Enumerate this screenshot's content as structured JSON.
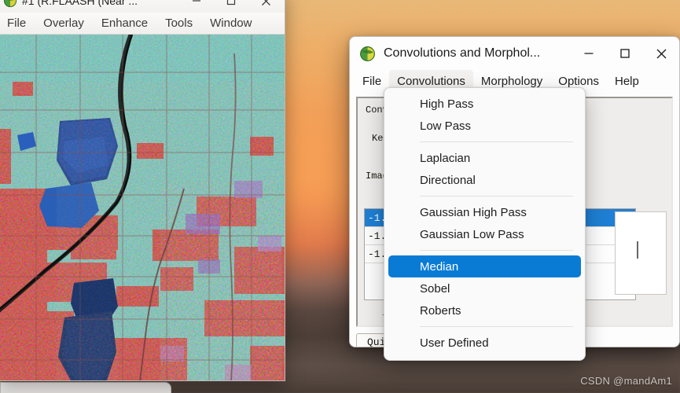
{
  "desktop": {
    "watermark": "CSDN @mandAm1"
  },
  "envi_window": {
    "icon": "envi-globe-icon",
    "title": "#1 (R:FLAASH (Near ...",
    "window_buttons": [
      {
        "name": "minimize",
        "glyph": "—"
      },
      {
        "name": "maximize",
        "glyph": "□"
      },
      {
        "name": "close",
        "glyph": "✕"
      }
    ],
    "menus": [
      "File",
      "Overlay",
      "Enhance",
      "Tools",
      "Window"
    ],
    "canvas_name": "false-color-satellite-image"
  },
  "conv_dialog": {
    "icon": "envi-globe-icon",
    "title": "Convolutions and Morphol...",
    "window_buttons": [
      {
        "name": "minimize",
        "glyph": "—"
      },
      {
        "name": "maximize",
        "glyph": "□"
      },
      {
        "name": "close",
        "glyph": "✕"
      }
    ],
    "menus": [
      {
        "label": "File",
        "active": false
      },
      {
        "label": "Convolutions",
        "active": true
      },
      {
        "label": "Morphology",
        "active": false
      },
      {
        "label": "Options",
        "active": false
      },
      {
        "label": "Help",
        "active": false
      }
    ],
    "body": {
      "label_convolution": "Conv",
      "label_kernel": "Kern",
      "label_image": "Imag",
      "kernel_rows": [
        {
          "value": "-1.0",
          "selected": true
        },
        {
          "value": "-1.0",
          "selected": false
        },
        {
          "value": "-1.0",
          "selected": false
        }
      ],
      "minus_mark": "-",
      "quit_label": "Qui"
    }
  },
  "dropdown": {
    "name": "convolutions-menu",
    "items": [
      {
        "label": "High Pass",
        "type": "item",
        "highlighted": false
      },
      {
        "label": "Low Pass",
        "type": "item",
        "highlighted": false
      },
      {
        "type": "separator"
      },
      {
        "label": "Laplacian",
        "type": "item",
        "highlighted": false
      },
      {
        "label": "Directional",
        "type": "item",
        "highlighted": false
      },
      {
        "type": "separator"
      },
      {
        "label": "Gaussian High Pass",
        "type": "item",
        "highlighted": false
      },
      {
        "label": "Gaussian Low Pass",
        "type": "item",
        "highlighted": false
      },
      {
        "type": "separator"
      },
      {
        "label": "Median",
        "type": "item",
        "highlighted": true
      },
      {
        "label": "Sobel",
        "type": "item",
        "highlighted": false
      },
      {
        "label": "Roberts",
        "type": "item",
        "highlighted": false
      },
      {
        "type": "separator"
      },
      {
        "label": "User Defined",
        "type": "item",
        "highlighted": false
      }
    ]
  },
  "colors": {
    "accent_highlight": "#0a7bd4",
    "list_selection": "#1f7fd4",
    "dialog_bg": "#fdfdfd",
    "menu_bg": "#fbfafa",
    "wallpaper_top": "#e8b878",
    "wallpaper_mid": "#ef9a55",
    "wallpaper_bottom": "#5a4c45"
  }
}
